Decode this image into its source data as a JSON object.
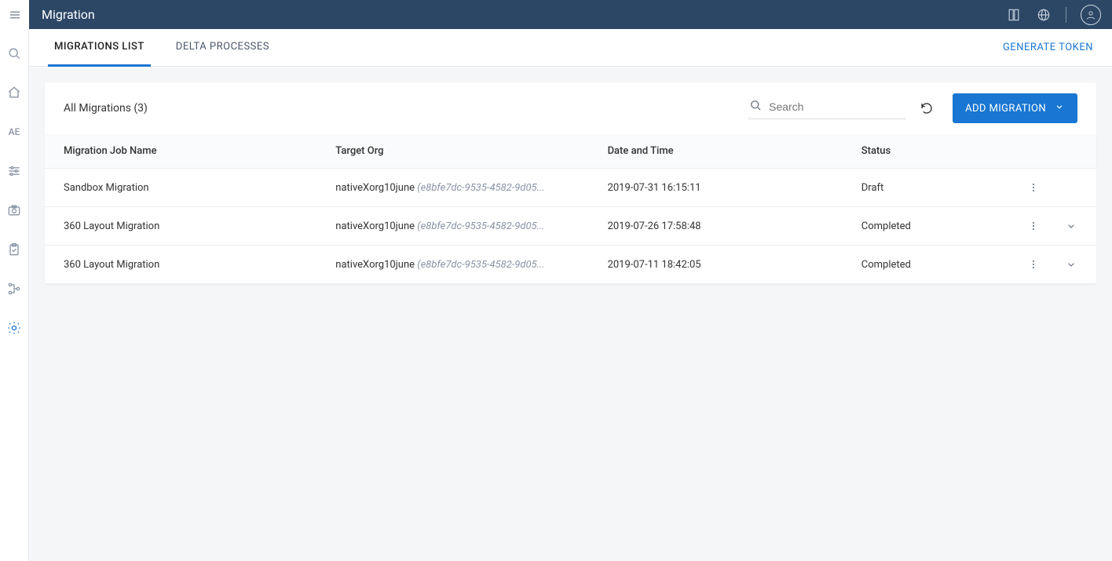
{
  "header": {
    "title": "Migration"
  },
  "tabs": [
    {
      "label": "MIGRATIONS LIST",
      "active": true
    },
    {
      "label": "DELTA PROCESSES",
      "active": false
    }
  ],
  "generate_token_label": "GENERATE TOKEN",
  "card": {
    "title": "All Migrations (3)",
    "search_placeholder": "Search",
    "add_button_label": "ADD MIGRATION"
  },
  "columns": {
    "name": "Migration Job Name",
    "target_org": "Target Org",
    "date": "Date and Time",
    "status": "Status"
  },
  "rows": [
    {
      "name": "Sandbox Migration",
      "org_name": "nativeXorg10june",
      "org_id": "(e8bfe7dc-9535-4582-9d05...",
      "date": "2019-07-31 16:15:11",
      "status": "Draft",
      "expandable": false
    },
    {
      "name": "360 Layout Migration",
      "org_name": "nativeXorg10june",
      "org_id": "(e8bfe7dc-9535-4582-9d05...",
      "date": "2019-07-26 17:58:48",
      "status": "Completed",
      "expandable": true
    },
    {
      "name": "360 Layout Migration",
      "org_name": "nativeXorg10june",
      "org_id": "(e8bfe7dc-9535-4582-9d05...",
      "date": "2019-07-11 18:42:05",
      "status": "Completed",
      "expandable": true
    }
  ],
  "sidebar": {
    "ae_label": "AE"
  }
}
